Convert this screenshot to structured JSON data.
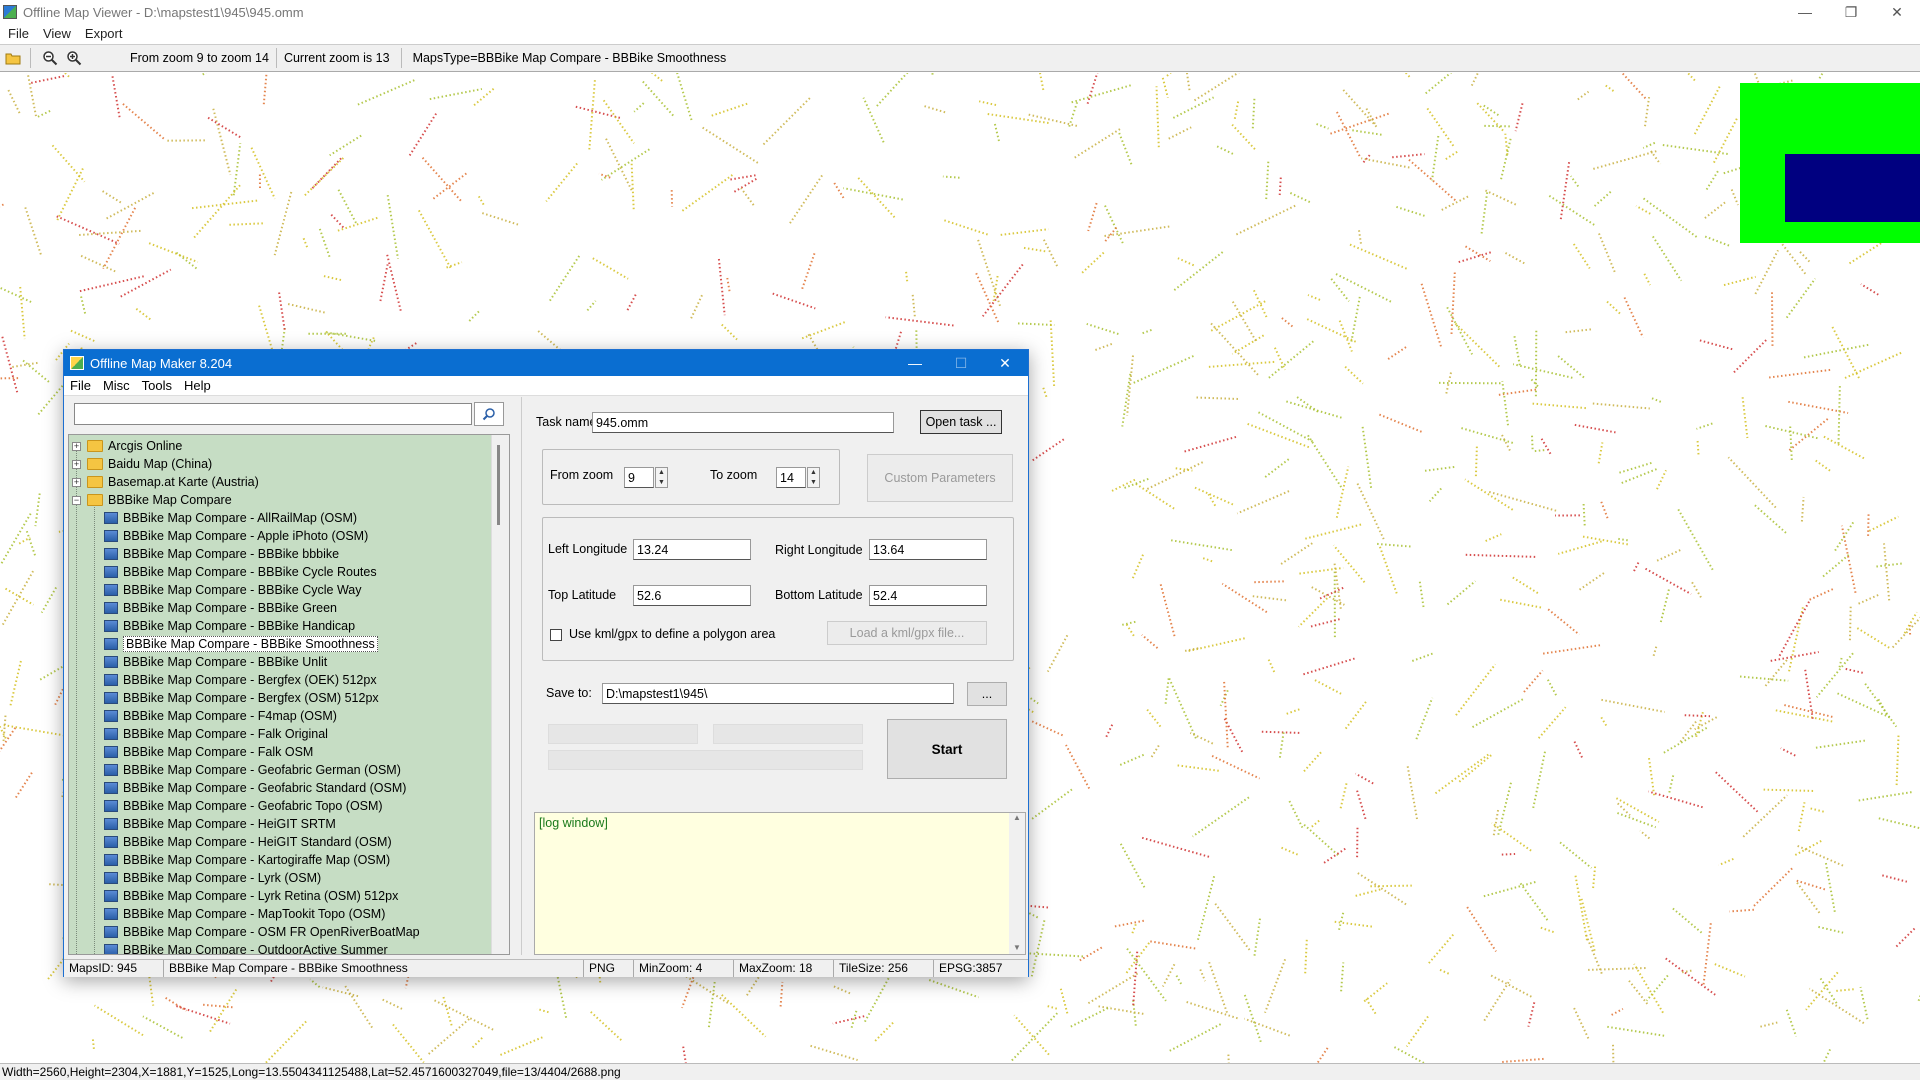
{
  "viewer": {
    "title": "Offline Map Viewer - D:\\mapstest1\\945\\945.omm",
    "menu": [
      "File",
      "View",
      "Export"
    ],
    "zoom_range": "From zoom 9 to zoom 14",
    "current_zoom": "Current zoom is 13",
    "maps_type": "MapsType=BBBike Map Compare - BBBike Smoothness",
    "status": "Width=2560,Height=2304,X=1881,Y=1525,Long=13.5504341125488,Lat=52.4571600327049,file=13/4404/2688.png",
    "controls": {
      "minimize": "—",
      "maximize": "❐",
      "close": "✕"
    }
  },
  "dialog": {
    "title": "Offline Map Maker 8.204",
    "menu": [
      "File",
      "Misc",
      "Tools",
      "Help"
    ],
    "search_value": "",
    "tree": {
      "folders": [
        {
          "label": "Arcgis Online",
          "expanded": false
        },
        {
          "label": "Baidu Map (China)",
          "expanded": false
        },
        {
          "label": "Basemap.at Karte (Austria)",
          "expanded": false
        },
        {
          "label": "BBBike Map Compare",
          "expanded": true
        }
      ],
      "items": [
        "BBBike Map Compare - AllRailMap (OSM)",
        "BBBike Map Compare - Apple iPhoto (OSM)",
        "BBBike Map Compare - BBBike bbbike",
        "BBBike Map Compare - BBBike Cycle Routes",
        "BBBike Map Compare - BBBike Cycle Way",
        "BBBike Map Compare - BBBike Green",
        "BBBike Map Compare - BBBike Handicap",
        "BBBike Map Compare - BBBike Smoothness",
        "BBBike Map Compare - BBBike Unlit",
        "BBBike Map Compare - Bergfex (OEK) 512px",
        "BBBike Map Compare - Bergfex (OSM) 512px",
        "BBBike Map Compare - F4map (OSM)",
        "BBBike Map Compare - Falk Original",
        "BBBike Map Compare - Falk OSM",
        "BBBike Map Compare - Geofabric German (OSM)",
        "BBBike Map Compare - Geofabric Standard (OSM)",
        "BBBike Map Compare - Geofabric Topo (OSM)",
        "BBBike Map Compare - HeiGIT SRTM",
        "BBBike Map Compare - HeiGIT Standard (OSM)",
        "BBBike Map Compare - Kartogiraffe Map (OSM)",
        "BBBike Map Compare - Lyrk (OSM)",
        "BBBike Map Compare - Lyrk Retina (OSM) 512px",
        "BBBike Map Compare - MapTookit Topo (OSM)",
        "BBBike Map Compare - OSM FR OpenRiverBoatMap",
        "BBBike Map Compare - OutdoorActive Summer"
      ],
      "selected_index": 7
    },
    "task_name_label": "Task name",
    "task_name_value": "945.omm",
    "open_task_label": "Open task ...",
    "from_zoom_label": "From zoom",
    "from_zoom_value": "9",
    "to_zoom_label": "To zoom",
    "to_zoom_value": "14",
    "custom_params_label": "Custom Parameters",
    "left_lon_label": "Left Longitude",
    "left_lon_value": "13.24",
    "right_lon_label": "Right Longitude",
    "right_lon_value": "13.64",
    "top_lat_label": "Top Latitude",
    "top_lat_value": "52.6",
    "bottom_lat_label": "Bottom Latitude",
    "bottom_lat_value": "52.4",
    "kml_checkbox_label": "Use kml/gpx to define a polygon area",
    "load_kml_label": "Load a kml/gpx file...",
    "save_to_label": "Save to:",
    "save_to_value": "D:\\mapstest1\\945\\",
    "browse_label": "...",
    "start_label": "Start",
    "log_text": "[log window]",
    "status": {
      "maps_id": "MapsID: 945",
      "maps_name": "BBBike Map Compare - BBBike Smoothness",
      "format": "PNG",
      "min_zoom": "MinZoom: 4",
      "max_zoom": "MaxZoom: 18",
      "tile_size": "TileSize: 256",
      "epsg": "EPSG:3857"
    }
  },
  "colors": {
    "map_dots": [
      "#d4c020",
      "#a8c030",
      "#e07030",
      "#d03030",
      "#c8b040"
    ],
    "overview_bg": "#00ff00",
    "overview_viewport": "#000080",
    "tree_bg": "#c6ddc4",
    "dialog_title": "#0a6ed1",
    "log_bg": "#ffffe0"
  }
}
